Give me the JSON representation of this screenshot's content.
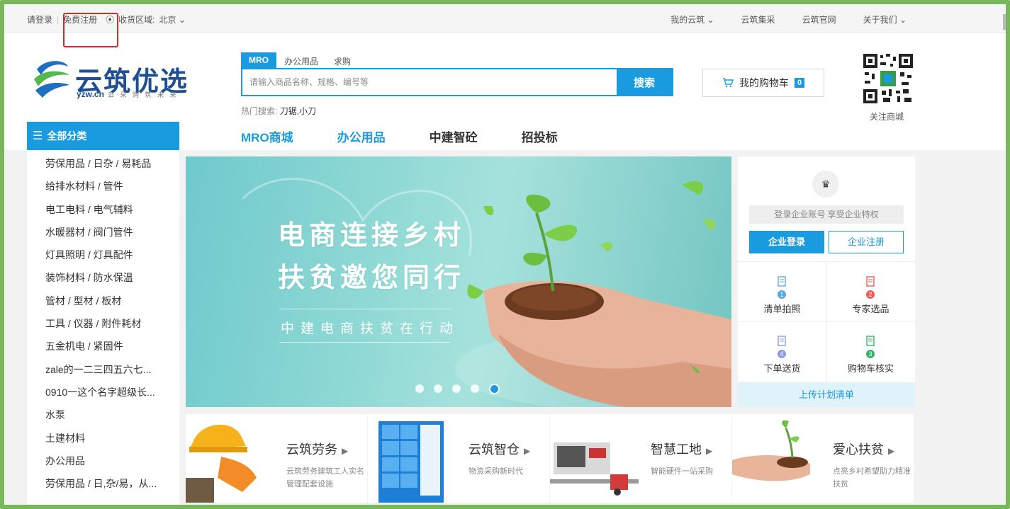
{
  "topbar": {
    "login": "请登录",
    "register": "免费注册",
    "region_label": "收货区域:",
    "region_value": "北京",
    "my_yunzhu": "我的云筑",
    "jicai": "云筑集采",
    "official": "云筑官网",
    "about": "关于我们"
  },
  "logo": {
    "name": "云筑优选",
    "domain": "yzw.cn",
    "slogan": "云 采 购 筑 未 来"
  },
  "search": {
    "tabs": [
      "MRO",
      "办公用品",
      "求购"
    ],
    "placeholder": "请输入商品名称、规格、编号等",
    "button": "搜索",
    "hot_label": "热门搜索:",
    "hot_terms": "刀锯,小刀"
  },
  "cart": {
    "label": "我的购物车",
    "count": "0"
  },
  "qr": {
    "label": "关注商城"
  },
  "nav": {
    "all_categories": "全部分类",
    "items": [
      "MRO商城",
      "办公用品",
      "中建智砼",
      "招投标"
    ]
  },
  "categories": [
    "劳保用品 / 日杂 / 易耗品",
    "给排水材料 / 管件",
    "电工电料 / 电气辅料",
    "水暖器材 / 阀门管件",
    "灯具照明 / 灯具配件",
    "装饰材料 / 防水保温",
    "管材 / 型材 / 板材",
    "工具 / 仪器 / 附件耗材",
    "五金机电 / 紧固件",
    "zale的一二三四五六七...",
    "0910一这个名字超级长...",
    "水泵",
    "土建材料",
    "办公用品",
    "劳保用品 / 日,杂/易，从..."
  ],
  "banner": {
    "title1": "电商连接乡村",
    "title2": "扶贫邀您同行",
    "tagline": "中建电商扶贫在行动",
    "slide_count": 5,
    "active_slide": 5
  },
  "side": {
    "tip": "登录企业账号 享受企业特权",
    "login_button": "企业登录",
    "register_button": "企业注册",
    "steps": [
      {
        "num": "1",
        "label": "清单拍照",
        "color": "#5aa9e6"
      },
      {
        "num": "2",
        "label": "专家选品",
        "color": "#ee5a5a"
      },
      {
        "num": "4",
        "label": "下单送货",
        "color": "#8f9be8"
      },
      {
        "num": "3",
        "label": "购物车核实",
        "color": "#35b36b"
      }
    ],
    "upload": "上传计划清单"
  },
  "services": [
    {
      "title": "云筑劳务",
      "desc": "云筑劳务建筑工人实名管理配套设施"
    },
    {
      "title": "云筑智仓",
      "desc": "物资采购新时代"
    },
    {
      "title": "智慧工地",
      "desc": "智能硬件一站采购"
    },
    {
      "title": "爱心扶贫",
      "desc": "点亮乡村希望助力精准扶贫"
    }
  ],
  "colors": {
    "accent": "#1a9bdf",
    "brand_dark": "#1d4f91",
    "outer_frame": "#79b85a",
    "annotation": "#e0262a"
  }
}
